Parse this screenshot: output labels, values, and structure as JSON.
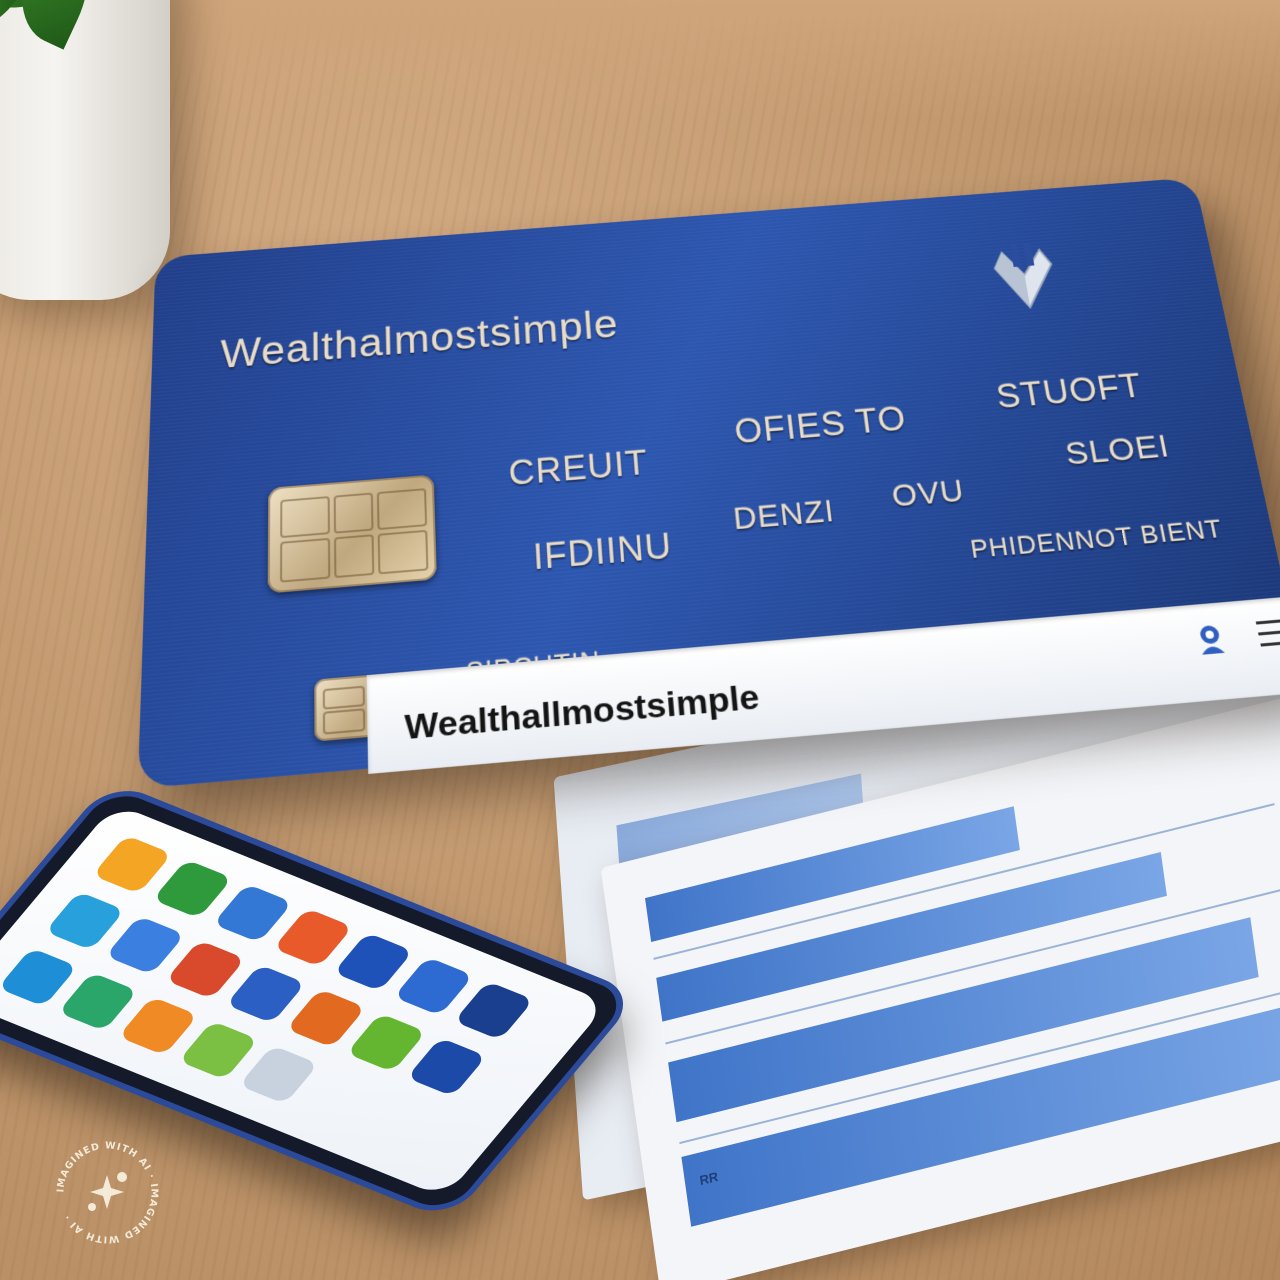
{
  "card": {
    "brand": "Wealthalmostsimple",
    "lines": [
      "CREUIT",
      "OFIES TO",
      "STUOFT",
      "SLOEI",
      "IFDIINU",
      "DENZI",
      "OVU",
      "PHIDENNOT BIENT",
      "SIPCUTIN"
    ],
    "bar_title": "Wealthallmostsimple"
  },
  "watermark": {
    "text": "IMAGINED WITH AI · IMAGINED WITH AI ·"
  },
  "document": {
    "label": "RR"
  },
  "icons": {
    "card_logo": "brand-logo-icon",
    "bar_user": "user-icon",
    "bar_menu": "menu-icon",
    "watermark": "sparkle-icon"
  },
  "colors": {
    "card_blue": "#2d57b0",
    "chip_gold": "#bfa77e",
    "doc_blue": "#3f74c8",
    "table_wood": "#c39a70"
  }
}
